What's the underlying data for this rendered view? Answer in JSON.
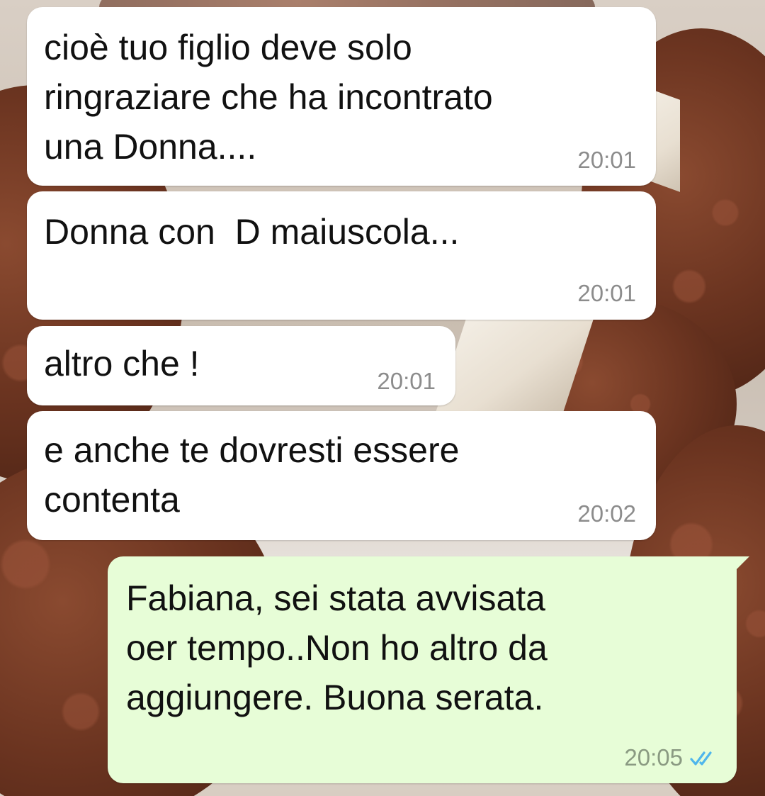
{
  "messages": [
    {
      "direction": "incoming",
      "text": "cioè tuo figlio deve solo\nringraziare che ha incontrato\nuna Donna....",
      "time": "20:01"
    },
    {
      "direction": "incoming",
      "text": "Donna con  D maiuscola...",
      "time": "20:01"
    },
    {
      "direction": "incoming",
      "text": "altro che !",
      "time": "20:01"
    },
    {
      "direction": "incoming",
      "text": "e anche te dovresti essere\ncontenta",
      "time": "20:02"
    },
    {
      "direction": "outgoing",
      "text": "Fabiana, sei stata avvisata\noer tempo..Non ho altro da\naggiungere. Buona serata.",
      "time": "20:05",
      "status_icon": "double-check-read-icon"
    }
  ],
  "colors": {
    "incoming_bubble": "#ffffff",
    "outgoing_bubble": "#e7fdd7",
    "read_tick": "#4fb6ec",
    "timestamp": "#8c8c8c"
  }
}
